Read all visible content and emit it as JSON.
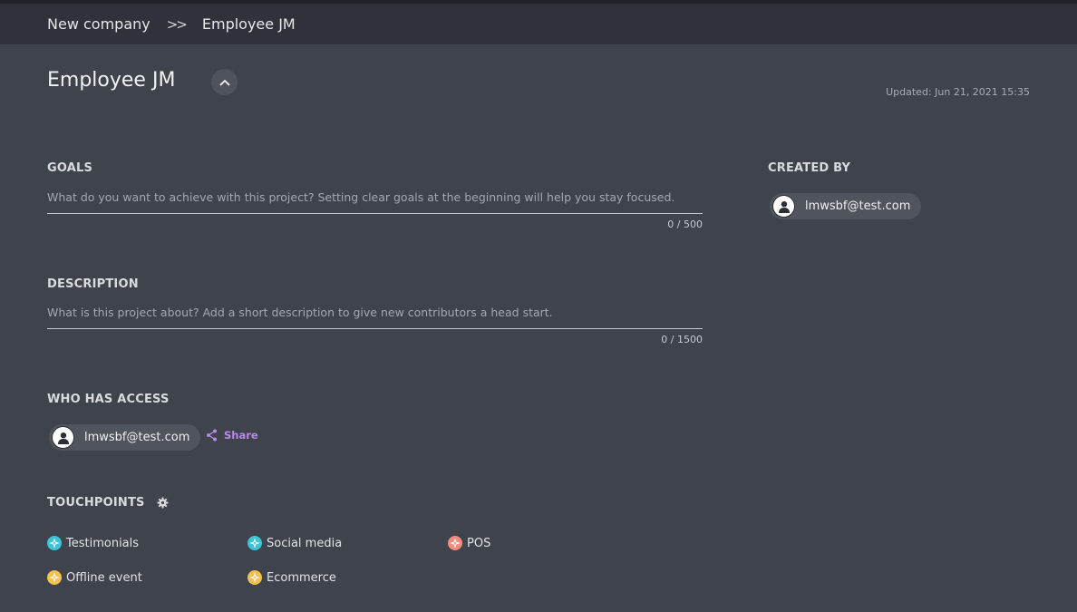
{
  "breadcrumb": {
    "items": [
      "New company",
      "Employee JM"
    ],
    "separator": ">>"
  },
  "page": {
    "title": "Employee JM",
    "updated": "Updated: Jun 21, 2021 15:35"
  },
  "goals": {
    "label": "GOALS",
    "placeholder": "What do you want to achieve with this project? Setting clear goals at the beginning will help you stay focused.",
    "counter": "0 / 500"
  },
  "description": {
    "label": "DESCRIPTION",
    "placeholder": "What is this project about? Add a short description to give new contributors a head start.",
    "counter": "0 / 1500"
  },
  "created_by": {
    "label": "CREATED BY",
    "user": "lmwsbf@test.com"
  },
  "access": {
    "label": "WHO HAS ACCESS",
    "user": "lmwsbf@test.com",
    "share_label": "Share"
  },
  "touchpoints": {
    "label": "TOUCHPOINTS",
    "items": [
      {
        "label": "Testimonials",
        "icon": "touchpoint-icon",
        "color": "#3fc3d9"
      },
      {
        "label": "Social media",
        "icon": "touchpoint-icon",
        "color": "#3fc3d9"
      },
      {
        "label": "POS",
        "icon": "touchpoint-icon",
        "color": "#f18c7e"
      },
      {
        "label": "Offline event",
        "icon": "touchpoint-icon",
        "color": "#f4c04e"
      },
      {
        "label": "Ecommerce",
        "icon": "touchpoint-icon",
        "color": "#f4c04e"
      }
    ]
  },
  "colors": {
    "background": "#3f434c",
    "header": "#2f323a",
    "accent_share": "#b58ae6"
  }
}
